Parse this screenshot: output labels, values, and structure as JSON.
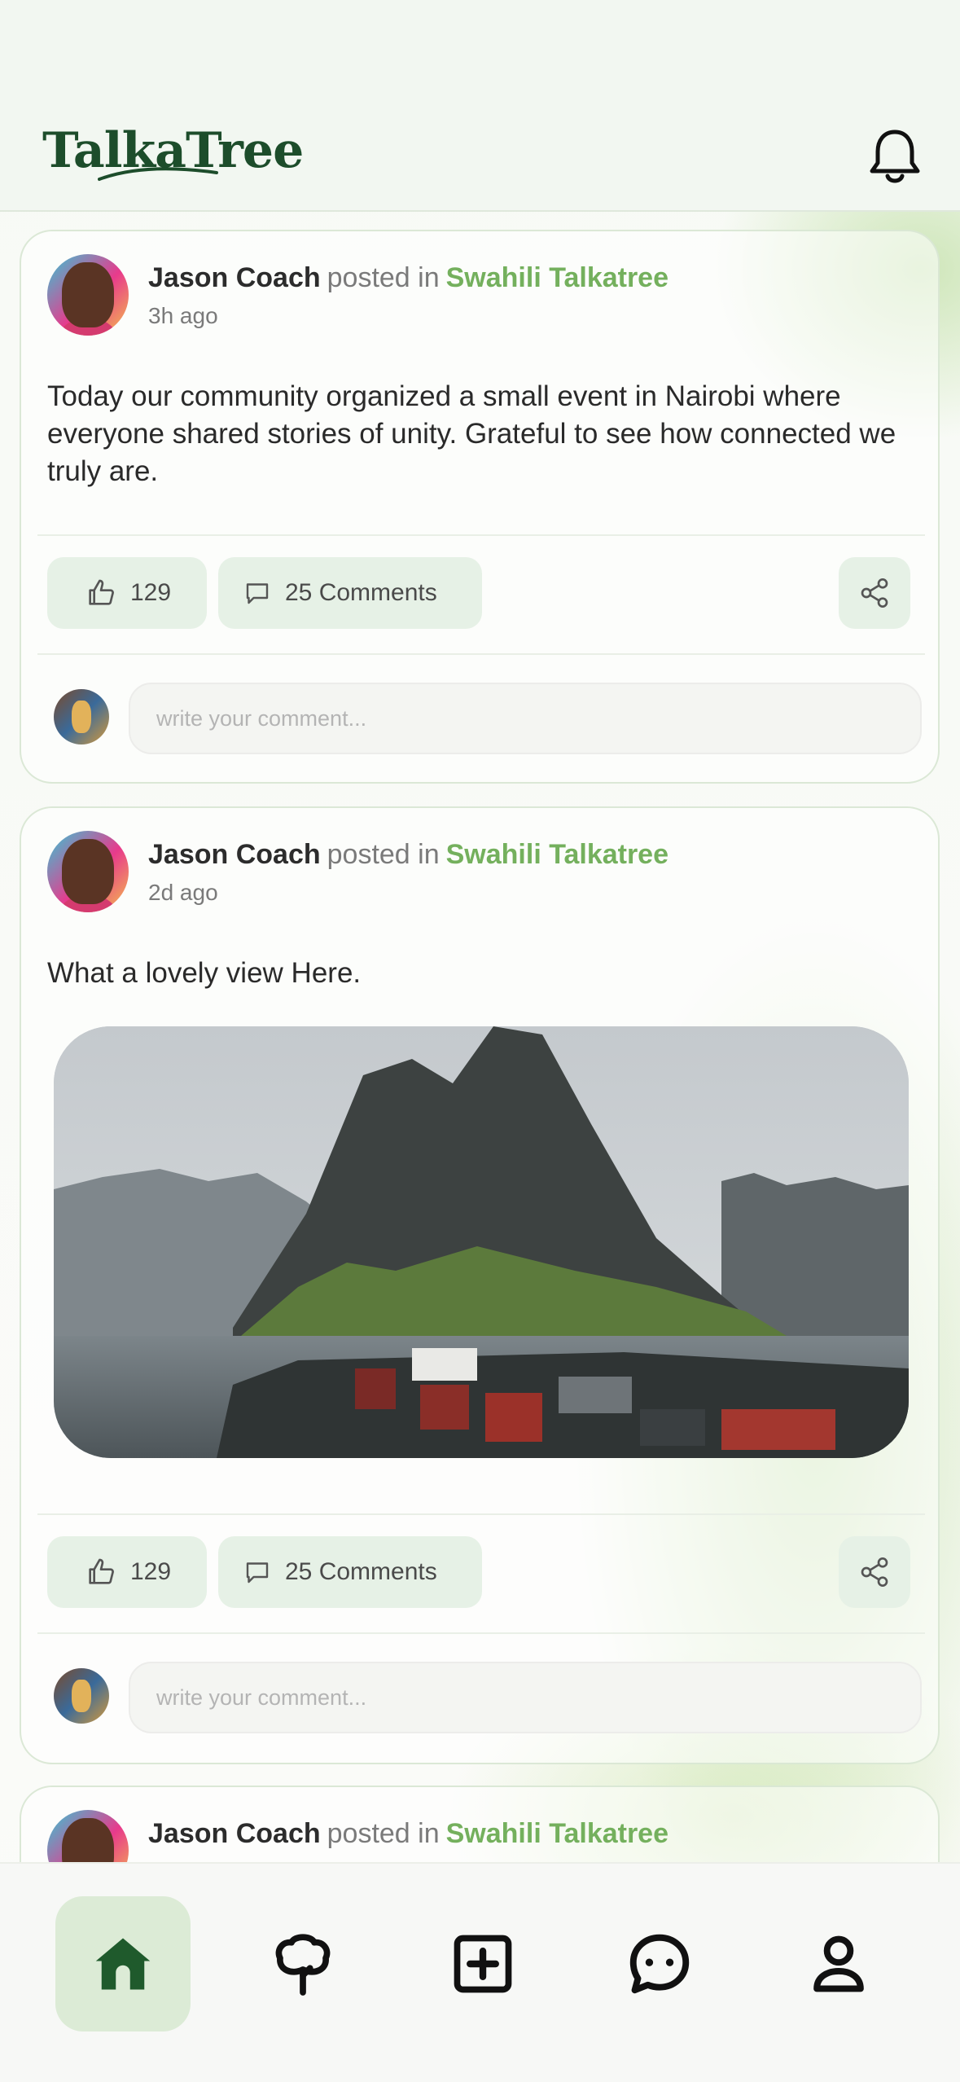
{
  "app": {
    "logo_text": "TalkaTree"
  },
  "posts": [
    {
      "author": "Jason Coach",
      "posted_in": "posted in",
      "group": "Swahili Talkatree",
      "time": "3h ago",
      "text": "Today our community organized a small event in Nairobi where everyone shared stories of unity. Grateful to see how connected we truly are.",
      "likes": "129",
      "comments": "25 Comments",
      "comment_placeholder": "write your comment..."
    },
    {
      "author": "Jason Coach",
      "posted_in": "posted in",
      "group": "Swahili Talkatree",
      "time": "2d ago",
      "text": "What a lovely view Here.",
      "has_image": true,
      "likes": "129",
      "comments": "25 Comments",
      "comment_placeholder": "write your comment..."
    },
    {
      "author": "Jason Coach",
      "posted_in": "posted in",
      "group": "Swahili Talkatree"
    }
  ],
  "nav": {
    "items": [
      {
        "icon": "home-icon",
        "active": true
      },
      {
        "icon": "tree-icon",
        "active": false
      },
      {
        "icon": "add-post-icon",
        "active": false
      },
      {
        "icon": "chat-icon",
        "active": false
      },
      {
        "icon": "profile-icon",
        "active": false
      }
    ]
  },
  "colors": {
    "brand": "#1d4d2b",
    "accent": "#74b05d",
    "chip_bg": "#e6f1e6",
    "nav_active_bg": "#dcebd6"
  }
}
